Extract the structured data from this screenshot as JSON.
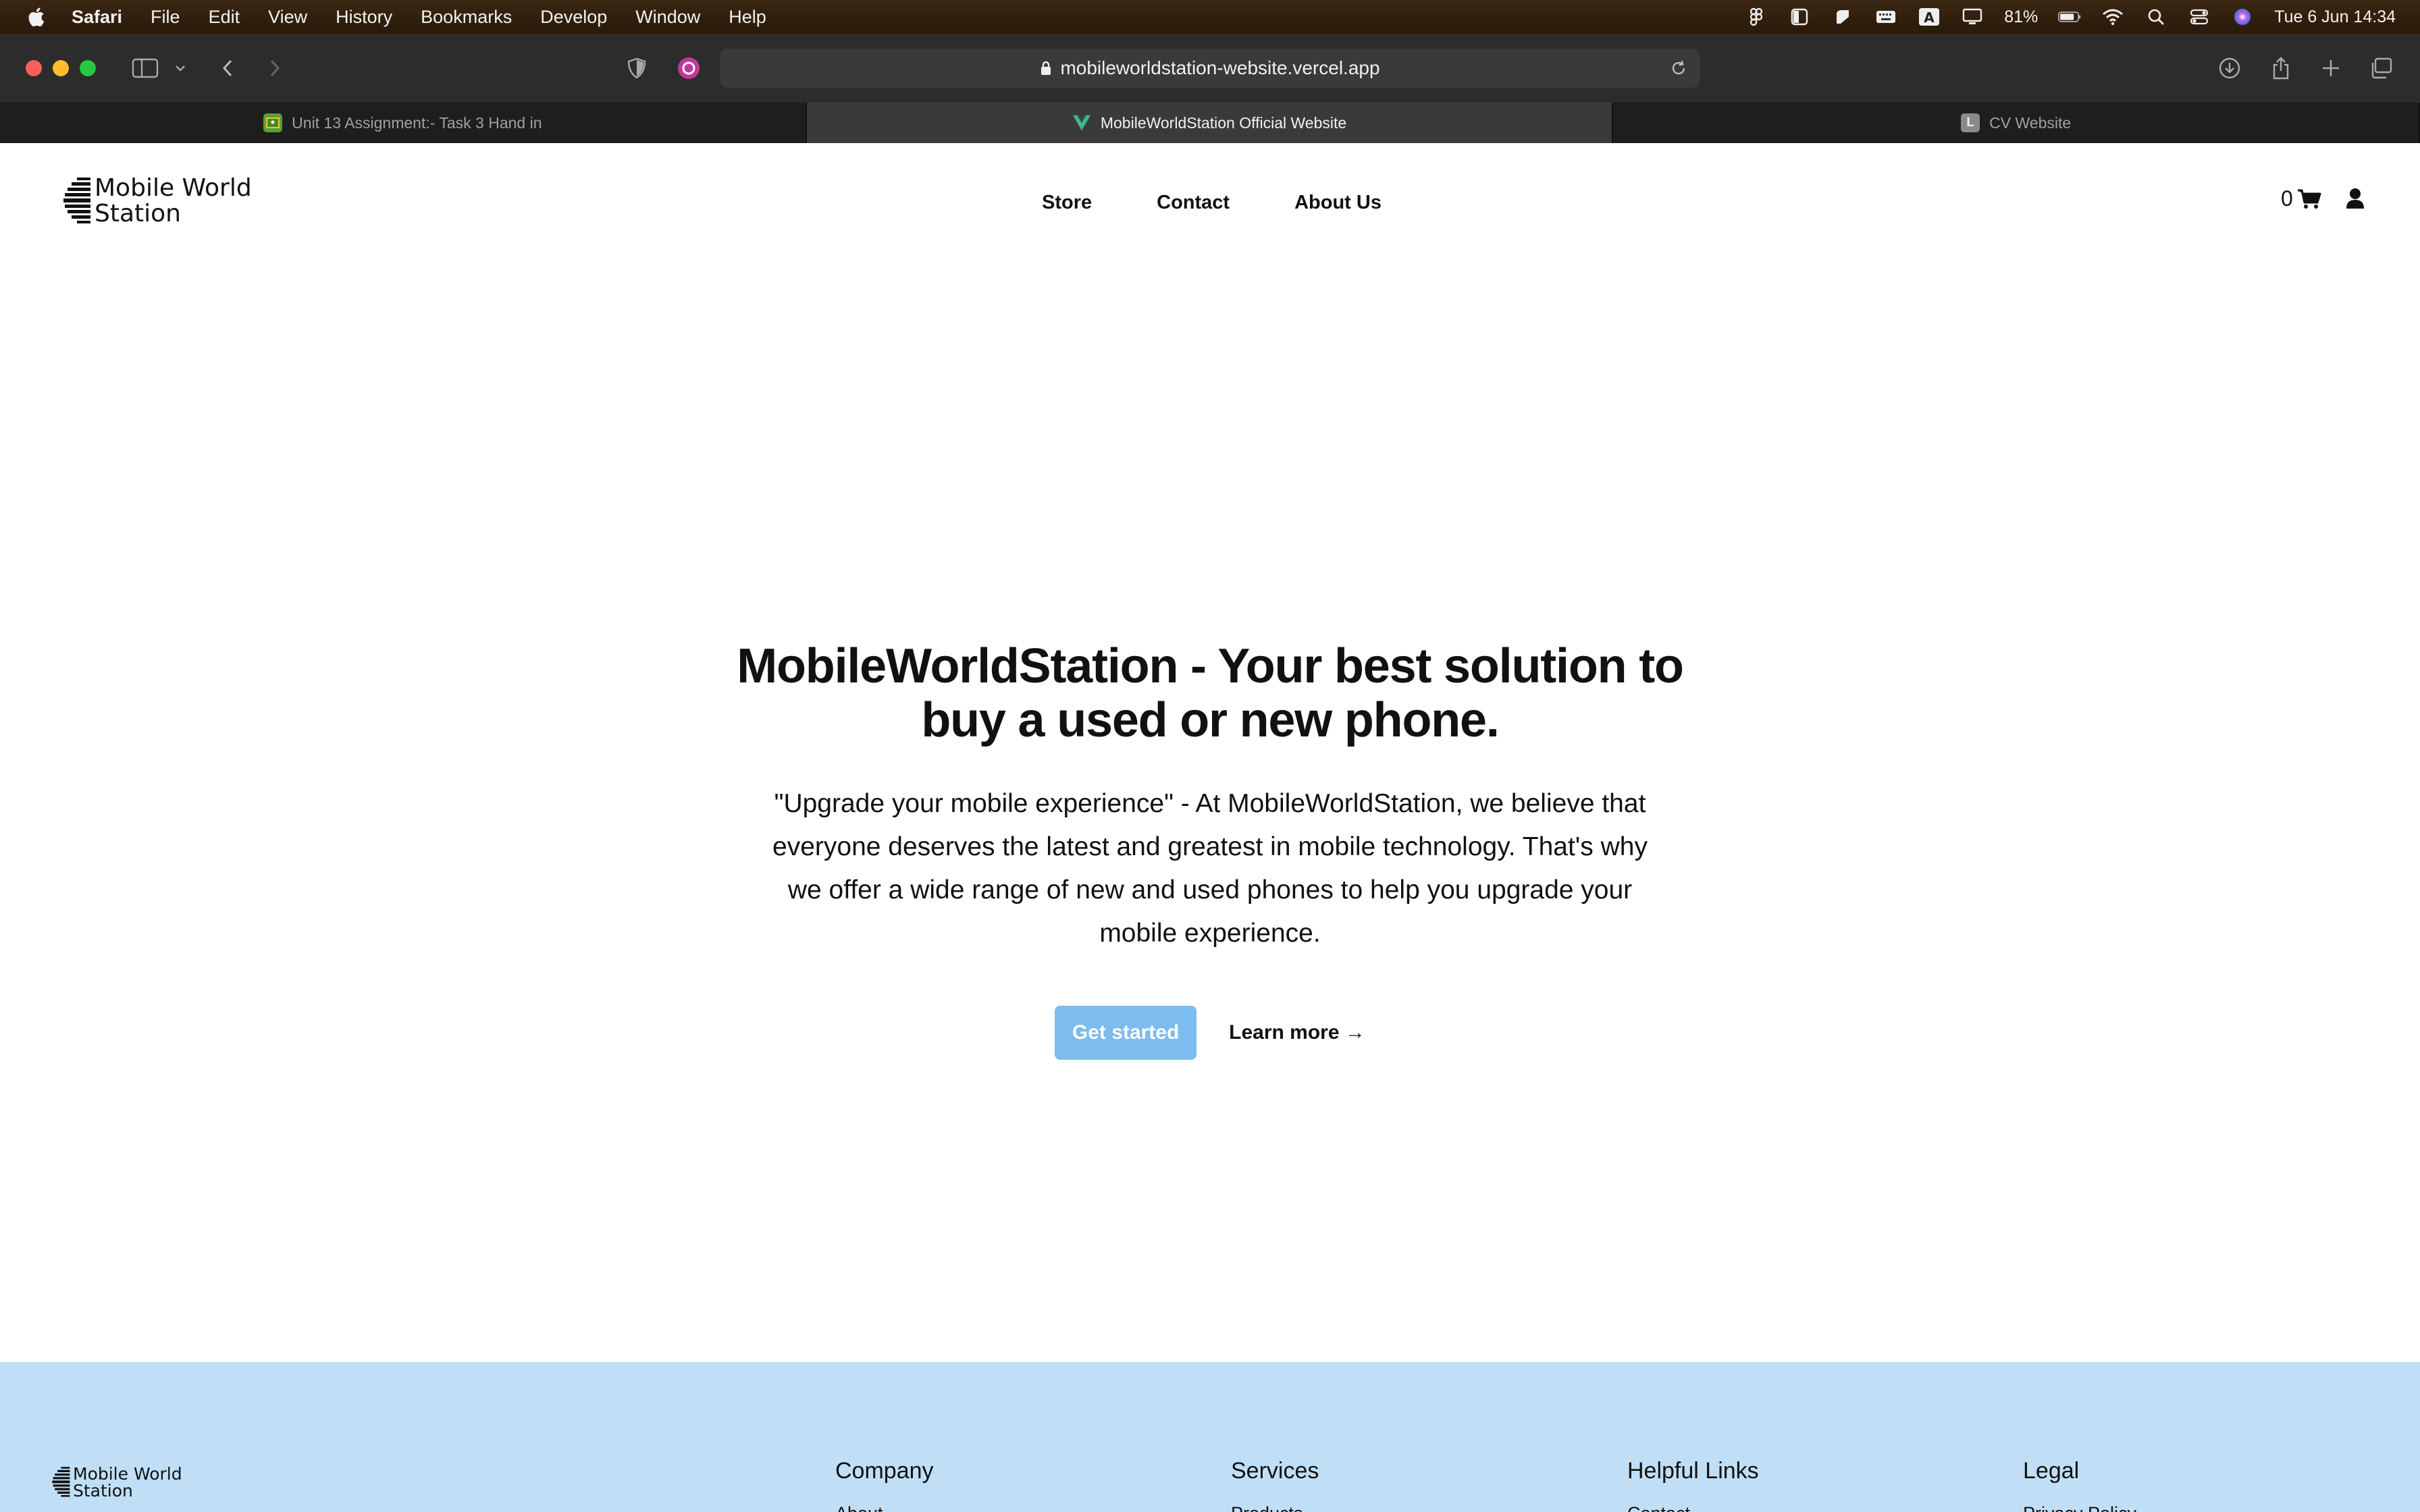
{
  "menubar": {
    "app_name": "Safari",
    "items": [
      "File",
      "Edit",
      "View",
      "History",
      "Bookmarks",
      "Develop",
      "Window",
      "Help"
    ],
    "battery": "81%",
    "datetime": "Tue 6 Jun  14:34"
  },
  "browser": {
    "url": "mobileworldstation-website.vercel.app",
    "tabs": [
      {
        "title": "Unit 13 Assignment:- Task 3 Hand in",
        "active": false
      },
      {
        "title": "MobileWorldStation Official Website",
        "active": true
      },
      {
        "title": "CV Website",
        "active": false,
        "favicon_letter": "L"
      }
    ]
  },
  "site": {
    "logo_line1": "Mobile World",
    "logo_line2": "Station",
    "nav": [
      "Store",
      "Contact",
      "About Us"
    ],
    "cart_count": "0",
    "hero": {
      "title": "MobileWorldStation - Your best solution to buy a used or new phone.",
      "description": "\"Upgrade your mobile experience\" - At MobileWorldStation, we believe that everyone deserves the latest and greatest in mobile technology. That's why we offer a wide range of new and used phones to help you upgrade your mobile experience.",
      "primary_cta": "Get started",
      "secondary_cta": "Learn more →"
    },
    "footer": {
      "columns": [
        {
          "title": "Company",
          "first_link": "About"
        },
        {
          "title": "Services",
          "first_link": "Products"
        },
        {
          "title": "Helpful Links",
          "first_link": "Contact"
        },
        {
          "title": "Legal",
          "first_link": "Privacy Policy"
        }
      ]
    }
  },
  "colors": {
    "cta_bg": "#7cbcee",
    "footer_bg": "#c0dff6",
    "menubar_bg": "#2a1a0a"
  }
}
